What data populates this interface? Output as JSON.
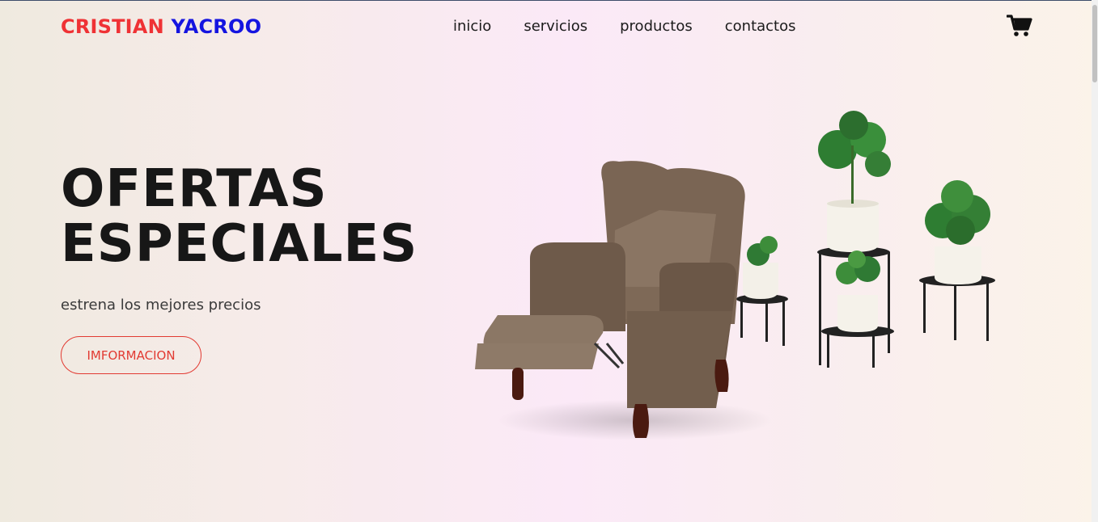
{
  "header": {
    "logo_first": "CRISTIAN",
    "logo_last": "YACROO",
    "nav": [
      "inicio",
      "servicios",
      "productos",
      "contactos"
    ],
    "cart_icon": "shopping-cart-icon"
  },
  "hero": {
    "title_line1": "OFERTAS",
    "title_line2": "ESPECIALES",
    "subtitle": "estrena los mejores precios",
    "button_label": "IMFORMACION"
  },
  "colors": {
    "logo_first": "#ef3235",
    "logo_last": "#1414e0",
    "button_accent": "#e23a32",
    "text_dark": "#171717"
  }
}
